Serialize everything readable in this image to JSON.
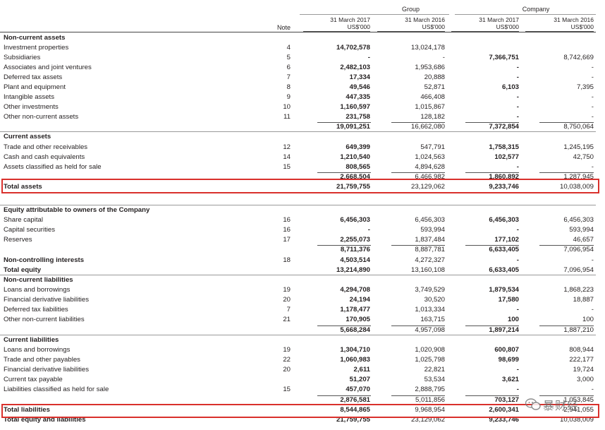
{
  "header": {
    "group_label": "Group",
    "company_label": "Company",
    "note_label": "Note",
    "columns": [
      {
        "date": "31 March 2017",
        "unit": "US$'000"
      },
      {
        "date": "31 March 2016",
        "unit": "US$'000"
      },
      {
        "date": "31 March 2017",
        "unit": "US$'000"
      },
      {
        "date": "31 March 2016",
        "unit": "US$'000"
      }
    ]
  },
  "rows": [
    {
      "label": "Non-current assets",
      "section": true
    },
    {
      "label": "Investment properties",
      "note": "4",
      "v": [
        "14,702,578",
        "13,024,178",
        "",
        ""
      ]
    },
    {
      "label": "Subsidiaries",
      "note": "5",
      "v": [
        "-",
        "-",
        "7,366,751",
        "8,742,669"
      ]
    },
    {
      "label": "Associates and joint ventures",
      "note": "6",
      "v": [
        "2,482,103",
        "1,953,686",
        "-",
        "-"
      ]
    },
    {
      "label": "Deferred tax assets",
      "note": "7",
      "v": [
        "17,334",
        "20,888",
        "-",
        "-"
      ]
    },
    {
      "label": "Plant and equipment",
      "note": "8",
      "v": [
        "49,546",
        "52,871",
        "6,103",
        "7,395"
      ]
    },
    {
      "label": "Intangible assets",
      "note": "9",
      "v": [
        "447,335",
        "466,408",
        "-",
        "-"
      ]
    },
    {
      "label": "Other investments",
      "note": "10",
      "v": [
        "1,160,597",
        "1,015,867",
        "-",
        "-"
      ]
    },
    {
      "label": "Other non-current assets",
      "note": "11",
      "v": [
        "231,758",
        "128,182",
        "-",
        "-"
      ]
    },
    {
      "label": "",
      "v": [
        "19,091,251",
        "16,662,080",
        "7,372,854",
        "8,750,064"
      ],
      "subtotal": true
    },
    {
      "label": "Current assets",
      "section": true
    },
    {
      "label": "Trade and other receivables",
      "note": "12",
      "v": [
        "649,399",
        "547,791",
        "1,758,315",
        "1,245,195"
      ]
    },
    {
      "label": "Cash and cash equivalents",
      "note": "14",
      "v": [
        "1,210,540",
        "1,024,563",
        "102,577",
        "42,750"
      ]
    },
    {
      "label": "Assets classified as held for sale",
      "note": "15",
      "v": [
        "808,565",
        "4,894,628",
        "-",
        "-"
      ]
    },
    {
      "label": "",
      "v": [
        "2,668,504",
        "6,466,982",
        "1,860,892",
        "1,287,945"
      ],
      "subtotal": true
    },
    {
      "label": "Total assets",
      "bold": true,
      "v": [
        "21,759,755",
        "23,129,062",
        "9,233,746",
        "10,038,009"
      ]
    },
    {
      "label": "Equity attributable to owners of the Company",
      "section": true
    },
    {
      "label": "Share capital",
      "note": "16",
      "v": [
        "6,456,303",
        "6,456,303",
        "6,456,303",
        "6,456,303"
      ]
    },
    {
      "label": "Capital securities",
      "note": "16",
      "v": [
        "-",
        "593,994",
        "-",
        "593,994"
      ]
    },
    {
      "label": "Reserves",
      "note": "17",
      "v": [
        "2,255,073",
        "1,837,484",
        "177,102",
        "46,657"
      ]
    },
    {
      "label": "",
      "v": [
        "8,711,376",
        "8,887,781",
        "6,633,405",
        "7,096,954"
      ],
      "subtotal": true
    },
    {
      "label": "Non-controlling interests",
      "note": "18",
      "bold": true,
      "v": [
        "4,503,514",
        "4,272,327",
        "-",
        "-"
      ]
    },
    {
      "label": "Total equity",
      "bold": true,
      "v": [
        "13,214,890",
        "13,160,108",
        "6,633,405",
        "7,096,954"
      ]
    },
    {
      "label": "Non-current liabilities",
      "section": true
    },
    {
      "label": "Loans and borrowings",
      "note": "19",
      "v": [
        "4,294,708",
        "3,749,529",
        "1,879,534",
        "1,868,223"
      ]
    },
    {
      "label": "Financial derivative liabilities",
      "note": "20",
      "v": [
        "24,194",
        "30,520",
        "17,580",
        "18,887"
      ]
    },
    {
      "label": "Deferred tax liabilities",
      "note": "7",
      "v": [
        "1,178,477",
        "1,013,334",
        "-",
        "-"
      ]
    },
    {
      "label": "Other non-current liabilities",
      "note": "21",
      "v": [
        "170,905",
        "163,715",
        "100",
        "100"
      ]
    },
    {
      "label": "",
      "v": [
        "5,668,284",
        "4,957,098",
        "1,897,214",
        "1,887,210"
      ],
      "subtotal": true
    },
    {
      "label": "Current liabilities",
      "section": true
    },
    {
      "label": "Loans and borrowings",
      "note": "19",
      "v": [
        "1,304,710",
        "1,020,908",
        "600,807",
        "808,944"
      ]
    },
    {
      "label": "Trade and other payables",
      "note": "22",
      "v": [
        "1,060,983",
        "1,025,798",
        "98,699",
        "222,177"
      ]
    },
    {
      "label": "Financial derivative liabilities",
      "note": "20",
      "v": [
        "2,611",
        "22,821",
        "-",
        "19,724"
      ]
    },
    {
      "label": "Current tax payable",
      "v": [
        "51,207",
        "53,534",
        "3,621",
        "3,000"
      ]
    },
    {
      "label": "Liabilities classified as held for sale",
      "note": "15",
      "v": [
        "457,070",
        "2,888,795",
        "-",
        "-"
      ]
    },
    {
      "label": "",
      "v": [
        "2,876,581",
        "5,011,856",
        "703,127",
        "1,053,845"
      ],
      "subtotal": true
    },
    {
      "label": "Total liabilities",
      "bold": true,
      "v": [
        "8,544,865",
        "9,968,954",
        "2,600,341",
        "2,941,055"
      ]
    },
    {
      "label": "Total equity and liabilities",
      "bold": true,
      "v": [
        "21,759,755",
        "23,129,062",
        "9,233,746",
        "10,038,009"
      ]
    }
  ],
  "watermark": {
    "text": "暴财经",
    "icon": "wechat-icon"
  },
  "colors": {
    "highlight_box": "#d9302c",
    "text": "#231f20"
  }
}
